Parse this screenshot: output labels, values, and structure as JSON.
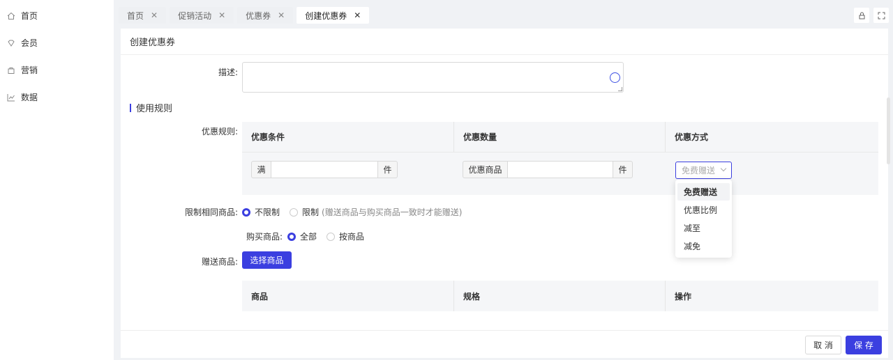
{
  "sidebar": {
    "items": [
      {
        "label": "首页",
        "icon": "home-icon"
      },
      {
        "label": "会员",
        "icon": "diamond-icon"
      },
      {
        "label": "营销",
        "icon": "bag-icon"
      },
      {
        "label": "数据",
        "icon": "chart-icon"
      }
    ]
  },
  "tabs": [
    {
      "label": "首页",
      "close": "✕"
    },
    {
      "label": "促销活动",
      "close": "✕"
    },
    {
      "label": "优惠券",
      "close": "✕"
    },
    {
      "label": "创建优惠券",
      "close": "✕",
      "active": true
    }
  ],
  "top_icons": [
    "lock-icon",
    "fullscreen-icon"
  ],
  "page": {
    "title": "创建优惠券",
    "description_label": "描述:",
    "section_title": "使用规则",
    "rule_label": "优惠规则:",
    "rule_table": {
      "headers": [
        "优惠条件",
        "优惠数量",
        "优惠方式"
      ],
      "condition_prefix": "满",
      "condition_suffix": "件",
      "quantity_prefix": "优惠商品",
      "quantity_suffix": "件",
      "method_placeholder": "免费赠送"
    },
    "method_options": [
      "免费赠送",
      "优惠比例",
      "减至",
      "减免"
    ],
    "method_selected": "免费赠送",
    "limit_label": "限制相同商品:",
    "limit_options": [
      "不限制",
      "限制"
    ],
    "limit_hint": "(赠送商品与购买商品一致时才能赠送)",
    "purchase_label": "购买商品:",
    "purchase_options": [
      "全部",
      "按商品"
    ],
    "gift_label": "赠送商品:",
    "select_goods_button": "选择商品",
    "goods_table_headers": [
      "商品",
      "规格",
      "操作"
    ]
  },
  "footer": {
    "cancel": "取 消",
    "save": "保 存"
  },
  "colors": {
    "primary": "#3b3fe0",
    "background": "#f0f2f5"
  }
}
